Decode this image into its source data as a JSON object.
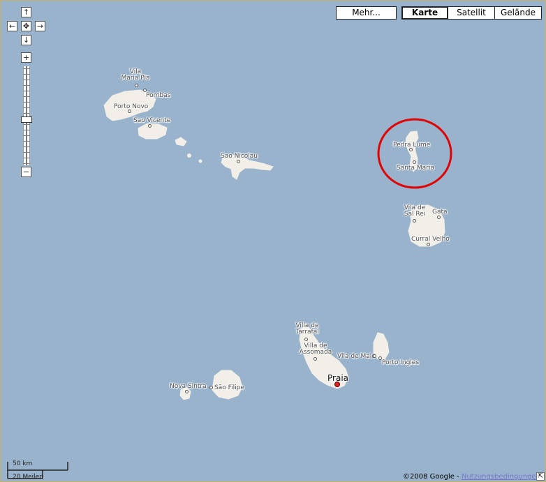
{
  "controls": {
    "pan_up": "↑",
    "pan_left": "←",
    "pan_center": "✥",
    "pan_right": "→",
    "pan_down": "↓",
    "zoom_in": "+",
    "zoom_out": "−"
  },
  "map_types": [
    {
      "label": "Mehr...",
      "active": false
    },
    {
      "label": "Karte",
      "active": true
    },
    {
      "label": "Satellit",
      "active": false
    },
    {
      "label": "Gelände",
      "active": false
    }
  ],
  "places": {
    "vila_maria_pia": "Vila\nMaria Pia",
    "pombas": "Pombas",
    "porto_novo": "Porto Novo",
    "sao_vicente": "Sao Vicente",
    "sao_nicolau": "Sao Nicolau",
    "pedra_lume": "Pedra Lume",
    "santa_maria": "Santa Maria",
    "vila_de_sal_rei": "Vila de\nSal Rei",
    "gata": "Gata",
    "curral_velho": "Curral Velho",
    "vila_de_tarrafal": "Villa de\nTarrafal",
    "vila_de_assomada": "Villa de\nAssomada",
    "vila_de_maio": "Vila de Maio",
    "porto_ingles": "Porto Ingles",
    "praia": "Praia",
    "nova_sintra": "Nova Sintra",
    "sao_filipe": "São Filipe"
  },
  "scale": {
    "km": "50 km",
    "miles": "20 Meilen"
  },
  "copyright": {
    "text": "©2008 Google - ",
    "link": "Nutzungsbedingungen"
  },
  "colors": {
    "water": "#99b3cc",
    "land": "#f2efe9",
    "highlight_circle": "#e00000"
  }
}
